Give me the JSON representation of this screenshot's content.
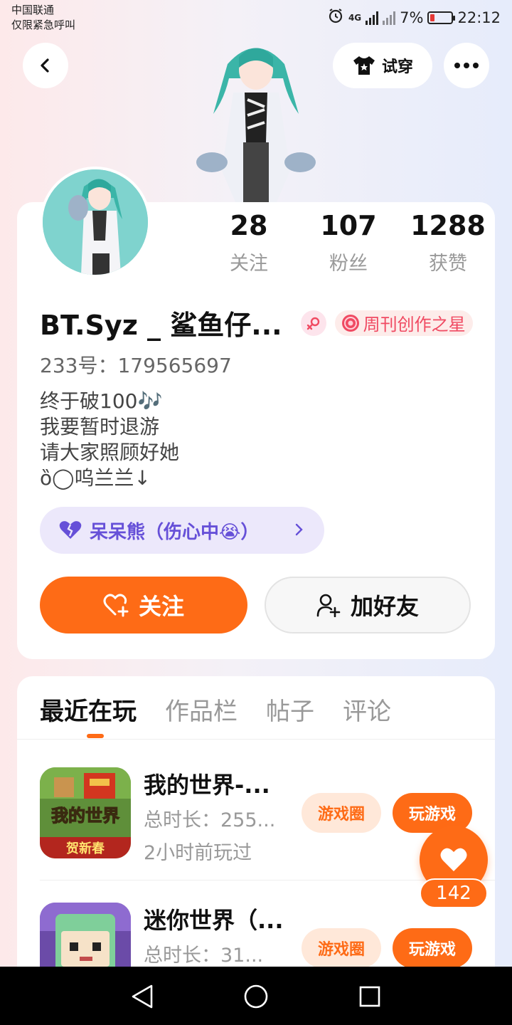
{
  "status_bar": {
    "carrier_line1": "中国联通",
    "carrier_line2": "仅限紧急呼叫",
    "battery": "7%",
    "time": "22:12",
    "network": "4G"
  },
  "header": {
    "tryon_label": "试穿"
  },
  "profile": {
    "stats": [
      {
        "value": "28",
        "label": "关注"
      },
      {
        "value": "107",
        "label": "粉丝"
      },
      {
        "value": "1288",
        "label": "获赞"
      }
    ],
    "username": "BT.Syz _ 鲨鱼仔...",
    "badge_label": "周刊创作之星",
    "uid": "233号：179565697",
    "bio": [
      "终于破100🎶",
      "我要暂时退游",
      "请大家照顾好她",
      "ȍ◯呜兰兰↓"
    ],
    "pet_label": "呆呆熊（伤心中😭）",
    "follow_label": "关注",
    "add_friend_label": "加好友"
  },
  "tabs": [
    {
      "label": "最近在玩",
      "active": true
    },
    {
      "label": "作品栏",
      "active": false
    },
    {
      "label": "帖子",
      "active": false
    },
    {
      "label": "评论",
      "active": false
    }
  ],
  "games": [
    {
      "title": "我的世界-...",
      "duration": "总时长：255...",
      "last_played": "2小时前玩过",
      "circle_label": "游戏圈",
      "play_label": "玩游戏",
      "icon_text": "我的世界",
      "icon_subtext": "贺新春"
    },
    {
      "title": "迷你世界（...",
      "duration": "总时长：31...",
      "last_played": "",
      "circle_label": "游戏圈",
      "play_label": "玩游戏"
    }
  ],
  "likes": {
    "count": "142"
  },
  "colors": {
    "accent": "#fe6b16",
    "pet_purple": "#6650d8",
    "badge_pink": "#f04a62"
  }
}
